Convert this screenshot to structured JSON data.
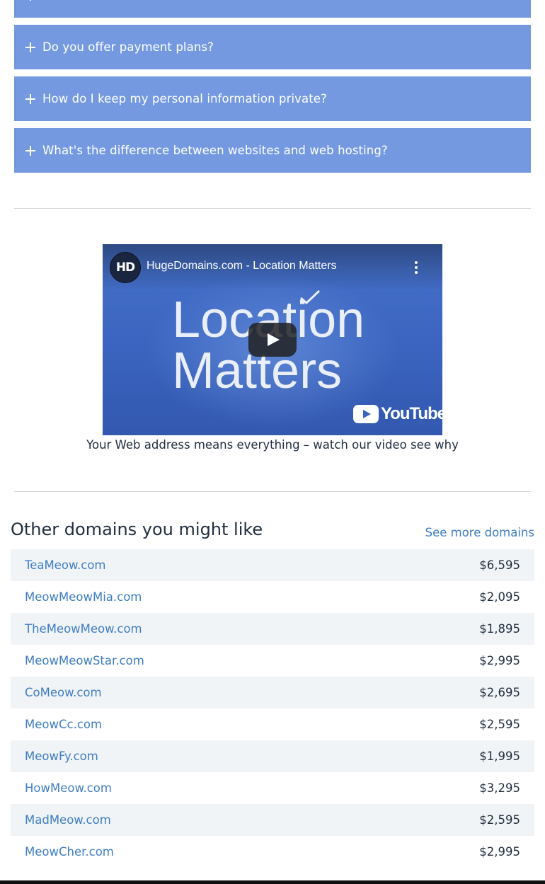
{
  "faq": {
    "items": [
      {
        "question": ""
      },
      {
        "question": "Do you offer payment plans?"
      },
      {
        "question": "How do I keep my personal information private?"
      },
      {
        "question": "What's the difference between websites and web hosting?"
      }
    ]
  },
  "video": {
    "channel_badge": "HD",
    "title": "HugeDomains.com - Location Matters",
    "headline_line1": "Location",
    "headline_line2": "Matters",
    "platform": "YouTube",
    "menu_icon": "more-vert-icon",
    "play_icon": "play-icon",
    "caption": "Your Web address means everything – watch our video see why"
  },
  "other_domains": {
    "title": "Other domains you might like",
    "see_more_label": "See more domains",
    "rows": [
      {
        "domain": "TeaMeow.com",
        "price": "$6,595"
      },
      {
        "domain": "MeowMeowMia.com",
        "price": "$2,095"
      },
      {
        "domain": "TheMeowMeow.com",
        "price": "$1,895"
      },
      {
        "domain": "MeowMeowStar.com",
        "price": "$2,995"
      },
      {
        "domain": "CoMeow.com",
        "price": "$2,695"
      },
      {
        "domain": "MeowCc.com",
        "price": "$2,595"
      },
      {
        "domain": "MeowFy.com",
        "price": "$1,995"
      },
      {
        "domain": "HowMeow.com",
        "price": "$3,295"
      },
      {
        "domain": "MadMeow.com",
        "price": "$2,595"
      },
      {
        "domain": "MeowCher.com",
        "price": "$2,995"
      }
    ]
  },
  "colors": {
    "faq_bg": "#7499e0",
    "link": "#3f7dc4",
    "row_alt": "#f1f4f7",
    "text": "#1f2d3d"
  }
}
